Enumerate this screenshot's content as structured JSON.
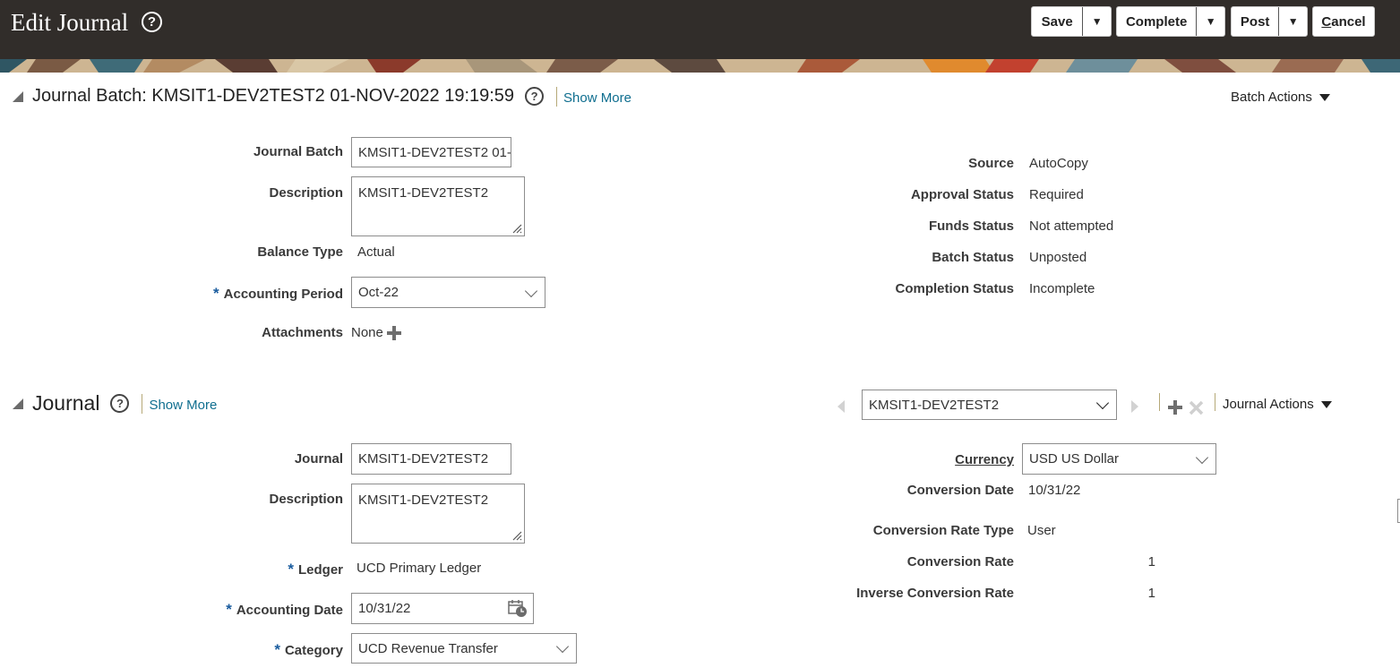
{
  "header": {
    "title": "Edit Journal",
    "buttons": {
      "save": "Save",
      "complete": "Complete",
      "post": "Post",
      "cancel_first": "C",
      "cancel_rest": "ancel"
    }
  },
  "batch": {
    "title": "Journal Batch: KMSIT1-DEV2TEST2 01-NOV-2022 19:19:59",
    "show_more": "Show More",
    "actions": "Batch Actions",
    "labels": {
      "journal_batch": "Journal Batch",
      "description": "Description",
      "balance_type": "Balance Type",
      "accounting_period": "Accounting Period",
      "attachments": "Attachments",
      "source": "Source",
      "approval_status": "Approval Status",
      "funds_status": "Funds Status",
      "batch_status": "Batch Status",
      "completion_status": "Completion Status"
    },
    "values": {
      "journal_batch": "KMSIT1-DEV2TEST2 01-",
      "description": "KMSIT1-DEV2TEST2",
      "balance_type": "Actual",
      "accounting_period": "Oct-22",
      "attachments": "None",
      "source": "AutoCopy",
      "approval_status": "Required",
      "funds_status": "Not attempted",
      "batch_status": "Unposted",
      "completion_status": "Incomplete"
    }
  },
  "journal": {
    "title": "Journal",
    "show_more": "Show More",
    "selector": "KMSIT1-DEV2TEST2",
    "actions": "Journal Actions",
    "labels": {
      "journal": "Journal",
      "description": "Description",
      "ledger": "Ledger",
      "accounting_date": "Accounting Date",
      "category": "Category",
      "currency": "Currency",
      "conversion_date": "Conversion Date",
      "conversion_rate_type": "Conversion Rate Type",
      "conversion_rate": "Conversion Rate",
      "inverse_conversion_rate": "Inverse Conversion Rate"
    },
    "values": {
      "journal": "KMSIT1-DEV2TEST2",
      "description": "KMSIT1-DEV2TEST2",
      "ledger": "UCD Primary Ledger",
      "accounting_date": "10/31/22",
      "category": "UCD Revenue Transfer",
      "currency": "USD US Dollar",
      "conversion_date": "10/31/22",
      "conversion_rate_type": "User",
      "conversion_rate": "1",
      "inverse_conversion_rate": "1"
    }
  },
  "required_marker": "*",
  "icons": {
    "help": "?",
    "add": "plus-icon",
    "delete": "x-icon",
    "calendar": "calendar-icon"
  },
  "colors": {
    "header_bg": "#312d2a",
    "link": "#0f6e8f",
    "required": "#1a5c9e"
  }
}
